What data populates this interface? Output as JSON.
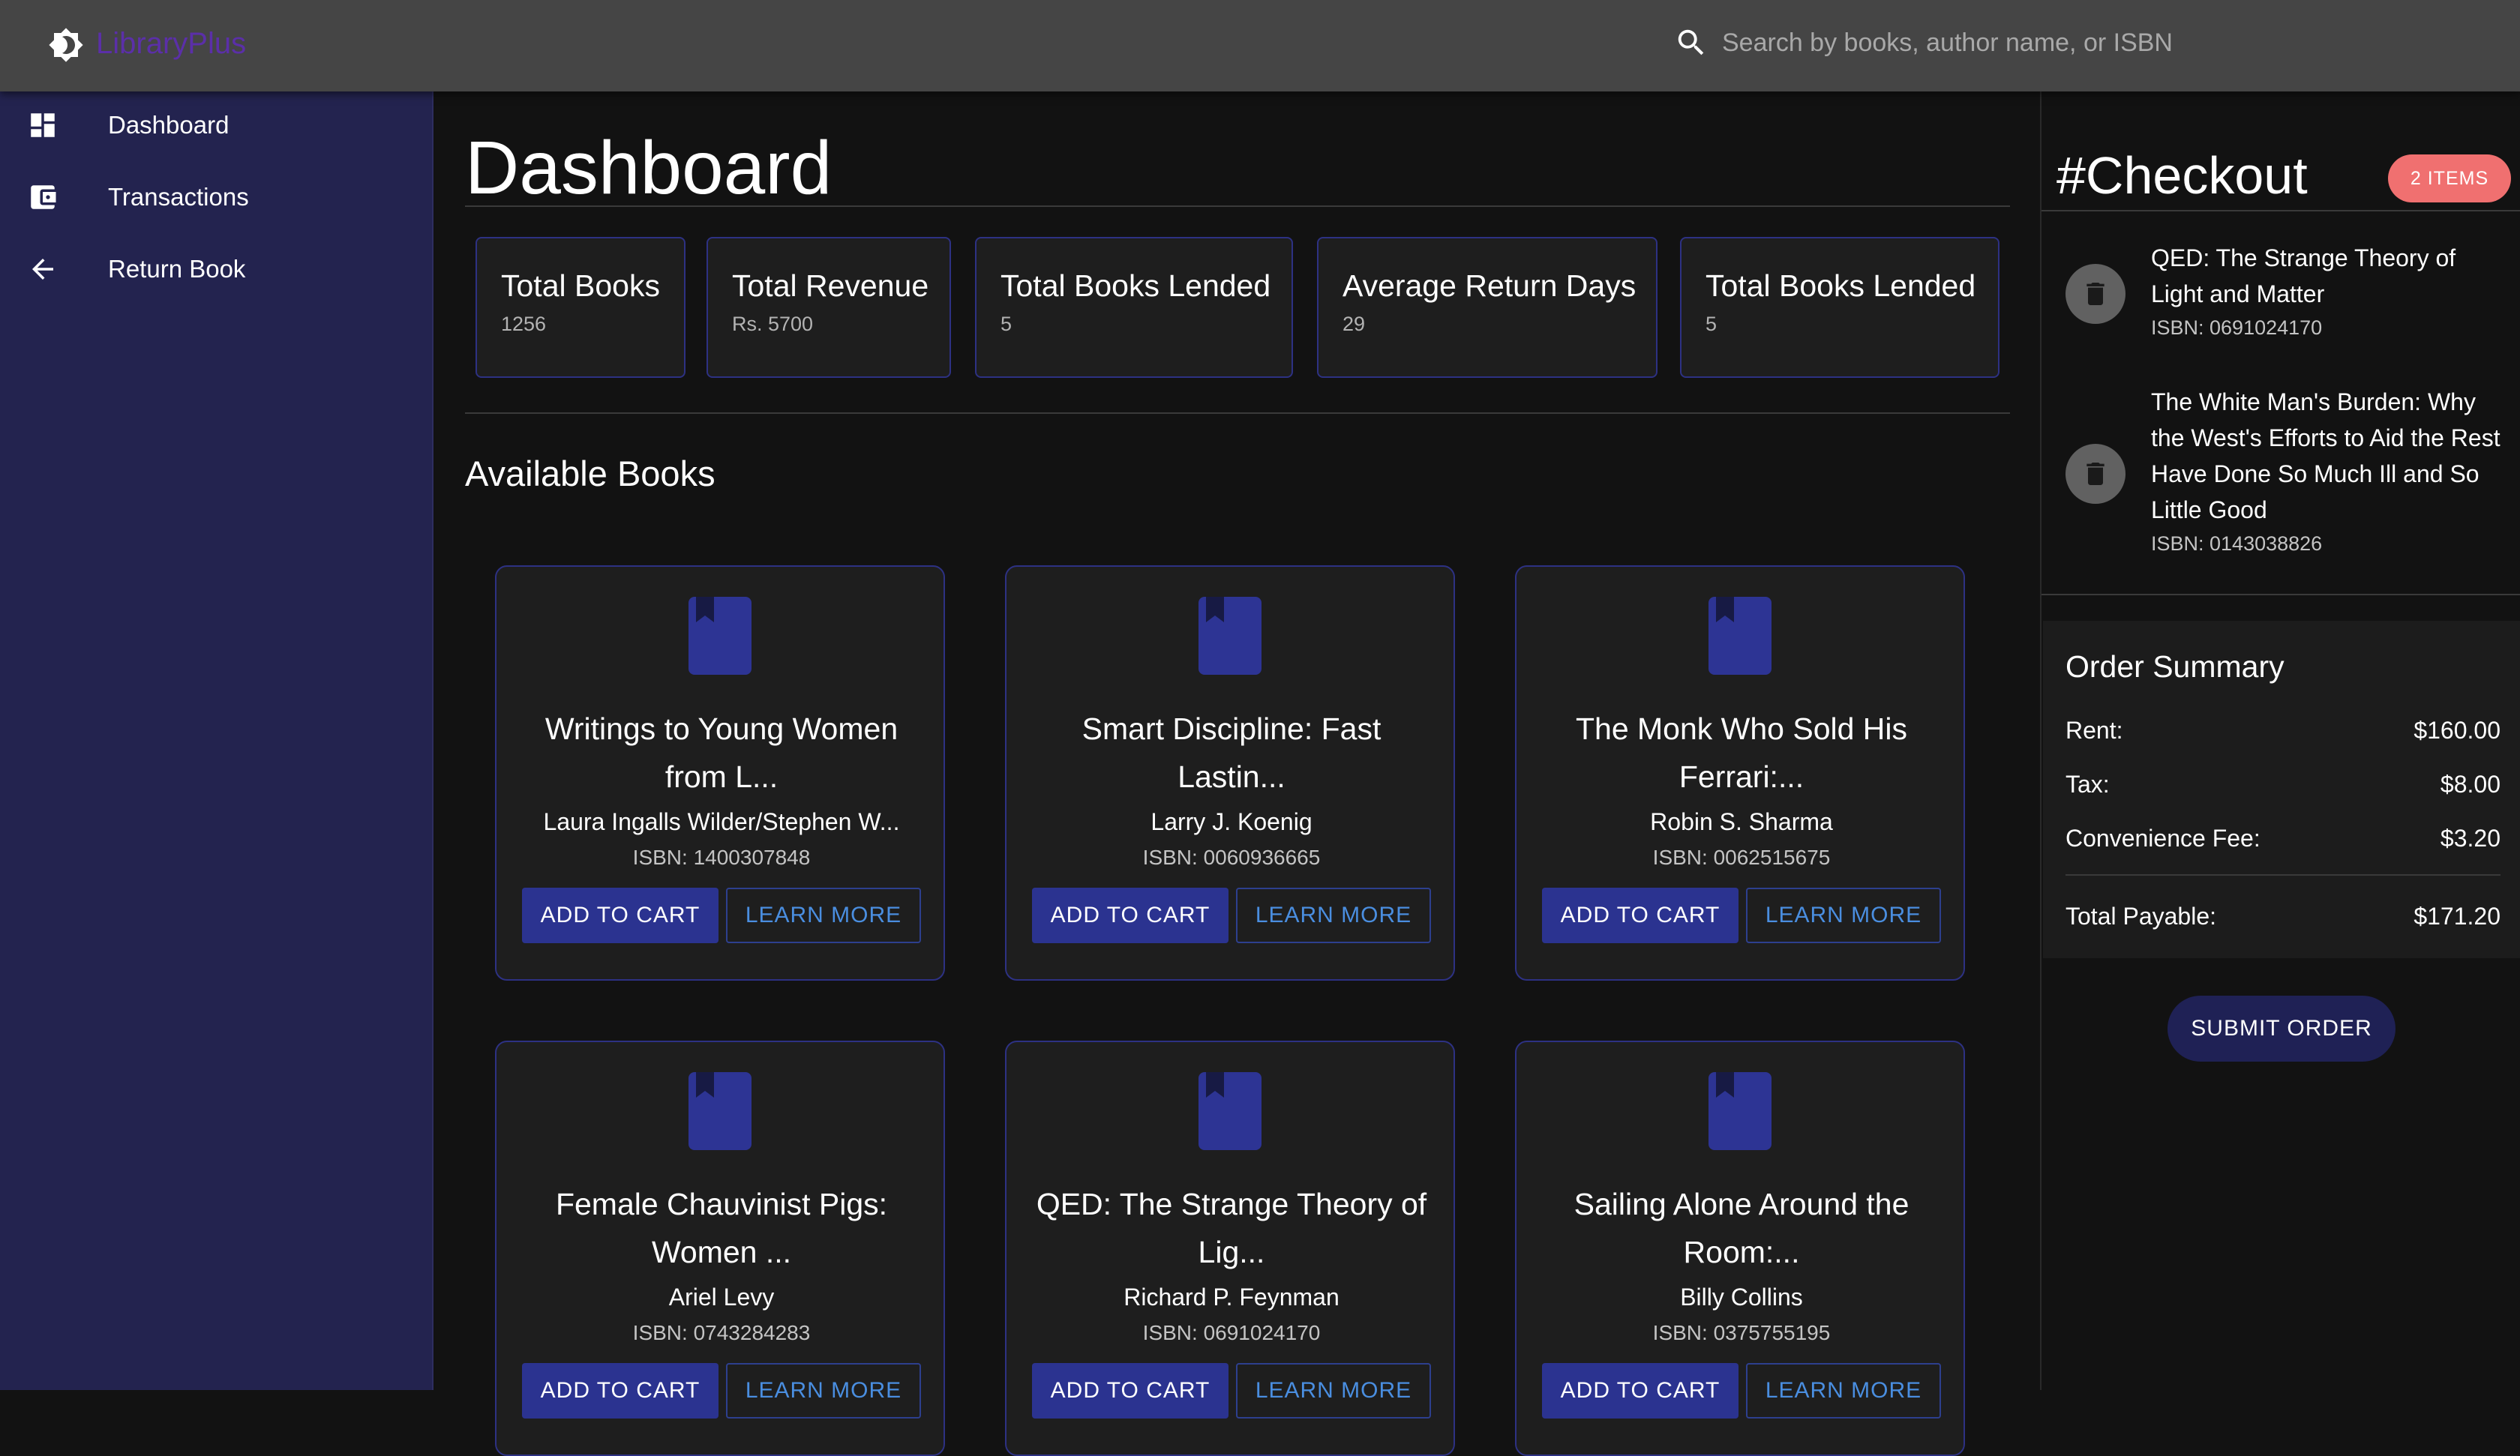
{
  "header": {
    "logo_icon": "brightness-icon",
    "brand": "LibraryPlus",
    "brand_color": "#5b2fa8",
    "search_icon": "search-icon",
    "search_placeholder": "Search by books, author name, or ISBN",
    "search_value": ""
  },
  "sidebar": {
    "items": [
      {
        "icon": "dashboard-icon",
        "label": "Dashboard"
      },
      {
        "icon": "wallet-icon",
        "label": "Transactions"
      },
      {
        "icon": "arrow-back-icon",
        "label": "Return Book"
      }
    ]
  },
  "main": {
    "title": "Dashboard",
    "stats": [
      {
        "title": "Total Books",
        "value": "1256"
      },
      {
        "title": "Total Revenue",
        "value": "Rs. 5700"
      },
      {
        "title": "Total Books Lended",
        "value": "5"
      },
      {
        "title": "Average Return Days",
        "value": "29"
      },
      {
        "title": "Total Books Lended",
        "value": "5"
      }
    ],
    "section_title": "Available Books",
    "add_to_cart_label": "ADD TO CART",
    "learn_more_label": "LEARN MORE",
    "books": [
      {
        "title": "Writings to Young Women from L...",
        "author": "Laura Ingalls Wilder/Stephen W...",
        "isbn": "ISBN: 1400307848"
      },
      {
        "title": "Smart Discipline: Fast Lastin...",
        "author": "Larry J. Koenig",
        "isbn": "ISBN: 0060936665"
      },
      {
        "title": "The Monk Who Sold His Ferrari:...",
        "author": "Robin S. Sharma",
        "isbn": "ISBN: 0062515675"
      },
      {
        "title": "Female Chauvinist Pigs: Women ...",
        "author": "Ariel Levy",
        "isbn": "ISBN: 0743284283"
      },
      {
        "title": "QED: The Strange Theory of Lig...",
        "author": "Richard P. Feynman",
        "isbn": "ISBN: 0691024170"
      },
      {
        "title": "Sailing Alone Around the Room:...",
        "author": "Billy Collins",
        "isbn": "ISBN: 0375755195"
      }
    ]
  },
  "checkout": {
    "title": "#Checkout",
    "badge": "2 ITEMS",
    "badge_color": "#f07070",
    "items": [
      {
        "title": "QED: The Strange Theory of Light and Matter",
        "isbn": "ISBN: 0691024170"
      },
      {
        "title": "The White Man's Burden: Why the West's Efforts to Aid the Rest Have Done So Much Ill and So Little Good",
        "isbn": "ISBN: 0143038826"
      }
    ],
    "summary": {
      "title": "Order Summary",
      "rent_label": "Rent:",
      "rent": "$160.00",
      "tax_label": "Tax:",
      "tax": "$8.00",
      "fee_label": "Convenience Fee:",
      "fee": "$3.20",
      "total_label": "Total Payable:",
      "total": "$171.20"
    },
    "submit_label": "SUBMIT ORDER"
  }
}
